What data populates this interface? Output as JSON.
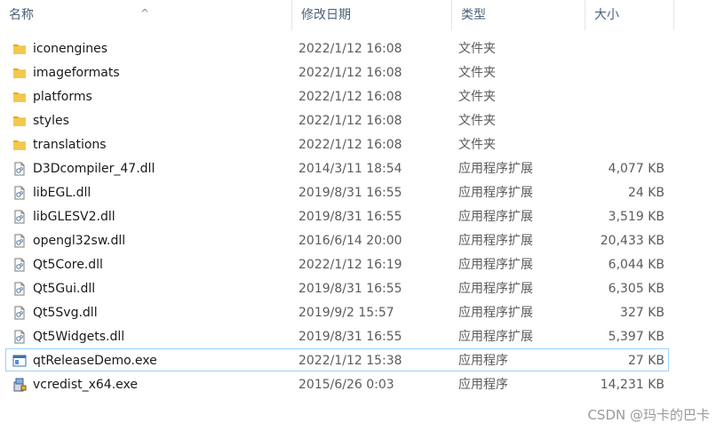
{
  "columns": {
    "name": "名称",
    "date": "修改日期",
    "type": "类型",
    "size": "大小"
  },
  "sort_indicator": "^",
  "files": [
    {
      "name": "iconengines",
      "date": "2022/1/12 16:08",
      "type": "文件夹",
      "size": "",
      "icon": "folder-icon"
    },
    {
      "name": "imageformats",
      "date": "2022/1/12 16:08",
      "type": "文件夹",
      "size": "",
      "icon": "folder-icon"
    },
    {
      "name": "platforms",
      "date": "2022/1/12 16:08",
      "type": "文件夹",
      "size": "",
      "icon": "folder-icon"
    },
    {
      "name": "styles",
      "date": "2022/1/12 16:08",
      "type": "文件夹",
      "size": "",
      "icon": "folder-icon"
    },
    {
      "name": "translations",
      "date": "2022/1/12 16:08",
      "type": "文件夹",
      "size": "",
      "icon": "folder-icon"
    },
    {
      "name": "D3Dcompiler_47.dll",
      "date": "2014/3/11 18:54",
      "type": "应用程序扩展",
      "size": "4,077 KB",
      "icon": "dll-file-icon"
    },
    {
      "name": "libEGL.dll",
      "date": "2019/8/31 16:55",
      "type": "应用程序扩展",
      "size": "24 KB",
      "icon": "dll-file-icon"
    },
    {
      "name": "libGLESV2.dll",
      "date": "2019/8/31 16:55",
      "type": "应用程序扩展",
      "size": "3,519 KB",
      "icon": "dll-file-icon"
    },
    {
      "name": "opengl32sw.dll",
      "date": "2016/6/14 20:00",
      "type": "应用程序扩展",
      "size": "20,433 KB",
      "icon": "dll-file-icon"
    },
    {
      "name": "Qt5Core.dll",
      "date": "2022/1/12 16:19",
      "type": "应用程序扩展",
      "size": "6,044 KB",
      "icon": "dll-file-icon"
    },
    {
      "name": "Qt5Gui.dll",
      "date": "2019/8/31 16:55",
      "type": "应用程序扩展",
      "size": "6,305 KB",
      "icon": "dll-file-icon"
    },
    {
      "name": "Qt5Svg.dll",
      "date": "2019/9/2 15:57",
      "type": "应用程序扩展",
      "size": "327 KB",
      "icon": "dll-file-icon"
    },
    {
      "name": "Qt5Widgets.dll",
      "date": "2019/8/31 16:55",
      "type": "应用程序扩展",
      "size": "5,397 KB",
      "icon": "dll-file-icon"
    },
    {
      "name": "qtReleaseDemo.exe",
      "date": "2022/1/12 15:38",
      "type": "应用程序",
      "size": "27 KB",
      "icon": "exe-app-icon",
      "focused": true
    },
    {
      "name": "vcredist_x64.exe",
      "date": "2015/6/26 0:03",
      "type": "应用程序",
      "size": "14,231 KB",
      "icon": "installer-icon"
    }
  ],
  "watermark": "CSDN @玛卡的巴卡",
  "colors": {
    "folder": "#f5c84a",
    "header_text": "#4c607a",
    "focus_border": "#99d1ff"
  }
}
